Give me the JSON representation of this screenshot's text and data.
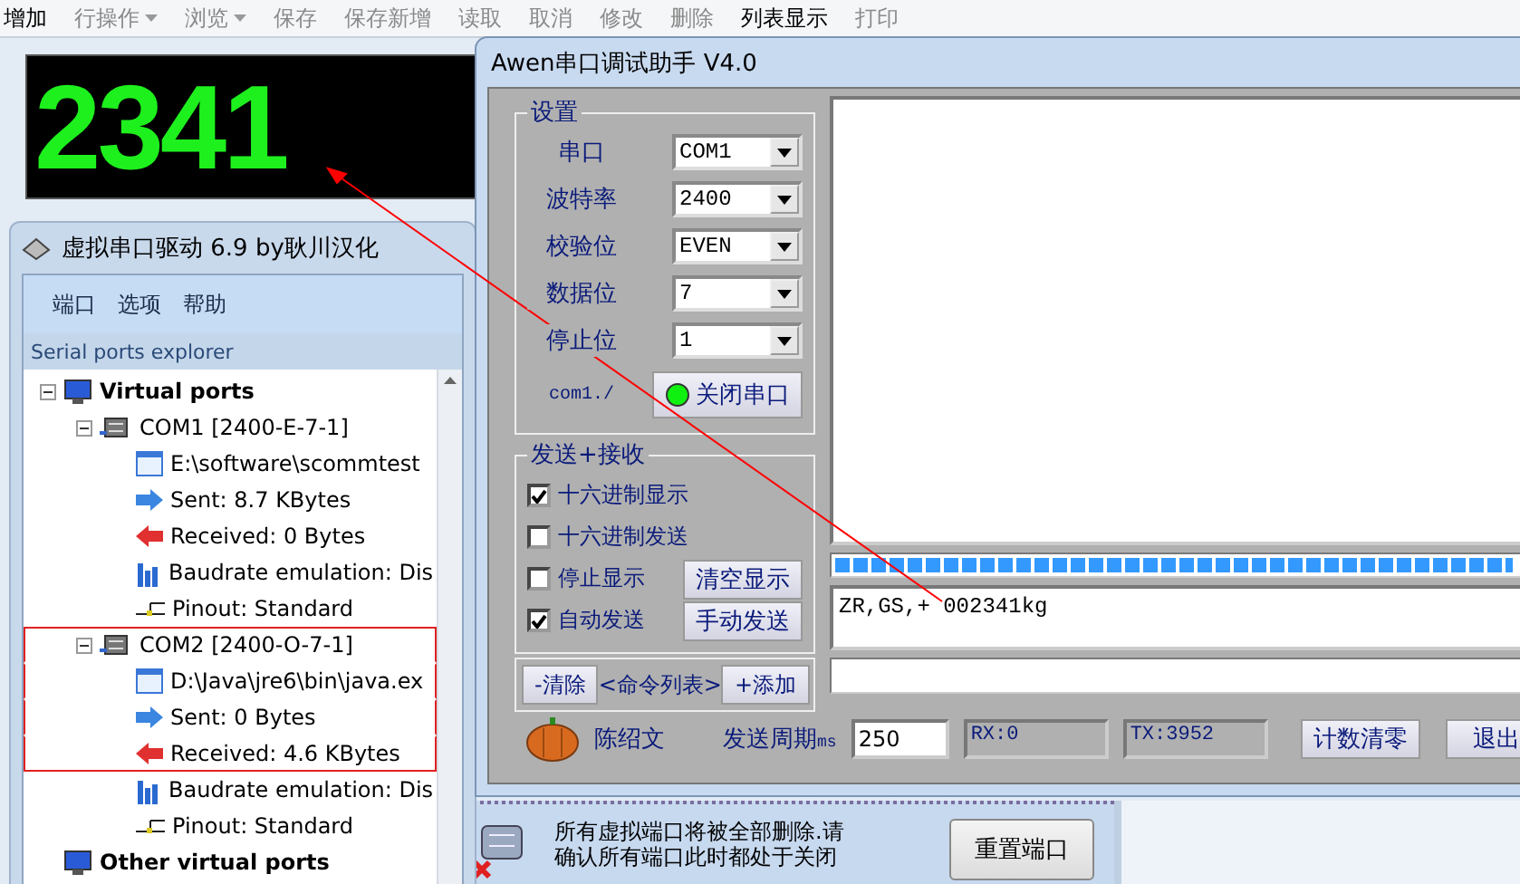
{
  "toolbar": [
    {
      "label": "增加",
      "disabled": false,
      "dropdown": false
    },
    {
      "label": "行操作",
      "disabled": true,
      "dropdown": true
    },
    {
      "label": "浏览",
      "disabled": true,
      "dropdown": true
    },
    {
      "label": "保存",
      "disabled": true,
      "dropdown": false
    },
    {
      "label": "保存新增",
      "disabled": true,
      "dropdown": false
    },
    {
      "label": "读取",
      "disabled": true,
      "dropdown": false
    },
    {
      "label": "取消",
      "disabled": true,
      "dropdown": false
    },
    {
      "label": "修改",
      "disabled": true,
      "dropdown": false
    },
    {
      "label": "删除",
      "disabled": true,
      "dropdown": false
    },
    {
      "label": "列表显示",
      "disabled": false,
      "dropdown": false
    },
    {
      "label": "打印",
      "disabled": true,
      "dropdown": false
    }
  ],
  "display": {
    "value": "2341"
  },
  "driver_window": {
    "title": "虚拟串口驱动 6.9 by耿川汉化",
    "menu": [
      "端口",
      "选项",
      "帮助"
    ],
    "panel_title": "Serial ports explorer",
    "tree": [
      {
        "label": "Virtual ports",
        "kind": "group",
        "expanded": true,
        "highlighted": false,
        "children": [
          {
            "label": "COM1 [2400-E-7-1]",
            "kind": "port",
            "expanded": true,
            "highlighted": false,
            "children": [
              {
                "label": "E:\\software\\scommtest",
                "kind": "app",
                "highlighted": false
              },
              {
                "label": "Sent: 8.7 KBytes",
                "kind": "sent",
                "highlighted": false
              },
              {
                "label": "Received: 0 Bytes",
                "kind": "received",
                "highlighted": false
              },
              {
                "label": "Baudrate emulation: Dis",
                "kind": "baud",
                "highlighted": false
              },
              {
                "label": "Pinout: Standard",
                "kind": "pinout",
                "highlighted": false
              }
            ]
          },
          {
            "label": "COM2 [2400-O-7-1]",
            "kind": "port",
            "expanded": true,
            "highlighted": true,
            "children": [
              {
                "label": "D:\\Java\\jre6\\bin\\java.ex",
                "kind": "app",
                "highlighted": true
              },
              {
                "label": "Sent: 0 Bytes",
                "kind": "sent",
                "highlighted": true
              },
              {
                "label": "Received: 4.6 KBytes",
                "kind": "received",
                "highlighted": true
              },
              {
                "label": "Baudrate emulation: Dis",
                "kind": "baud",
                "highlighted": false
              },
              {
                "label": "Pinout: Standard",
                "kind": "pinout",
                "highlighted": false
              }
            ]
          }
        ]
      },
      {
        "label": "Other virtual ports",
        "kind": "group",
        "expanded": false,
        "highlighted": false
      }
    ]
  },
  "info_panel": {
    "lines": [
      "所有虚拟端口将被全部删除.请",
      "确认所有端口此时都处于关闭"
    ],
    "button": "重置端口"
  },
  "assistant_window": {
    "title": "Awen串口调试助手 V4.0",
    "settings": {
      "title": "设置",
      "fields": [
        {
          "label": "串口",
          "value": "COM1"
        },
        {
          "label": "波特率",
          "value": "2400"
        },
        {
          "label": "校验位",
          "value": "EVEN"
        },
        {
          "label": "数据位",
          "value": "7"
        },
        {
          "label": "停止位",
          "value": "1"
        }
      ],
      "status": "com1./",
      "port_open": true,
      "open_button": "关闭串口"
    },
    "send_receive": {
      "title": "发送+接收",
      "options": [
        {
          "label": "十六进制显示",
          "checked": true
        },
        {
          "label": "十六进制发送",
          "checked": false
        },
        {
          "label": "停止显示",
          "checked": false,
          "button": "清空显示"
        },
        {
          "label": "自动发送",
          "checked": true,
          "button": "手动发送"
        }
      ]
    },
    "commands": {
      "clear": "-清除",
      "label": "<命令列表>",
      "add": "+添加"
    },
    "author": "陈绍文",
    "period": {
      "label": "发送周期",
      "unit": "ms",
      "value": "250"
    },
    "rx": "RX:0",
    "tx": "TX:3952",
    "reset_button": "计数清零",
    "exit_button": "退出",
    "progress": {
      "level": 0.96
    },
    "send_text": "ZR,GS,+ 002341kg"
  }
}
